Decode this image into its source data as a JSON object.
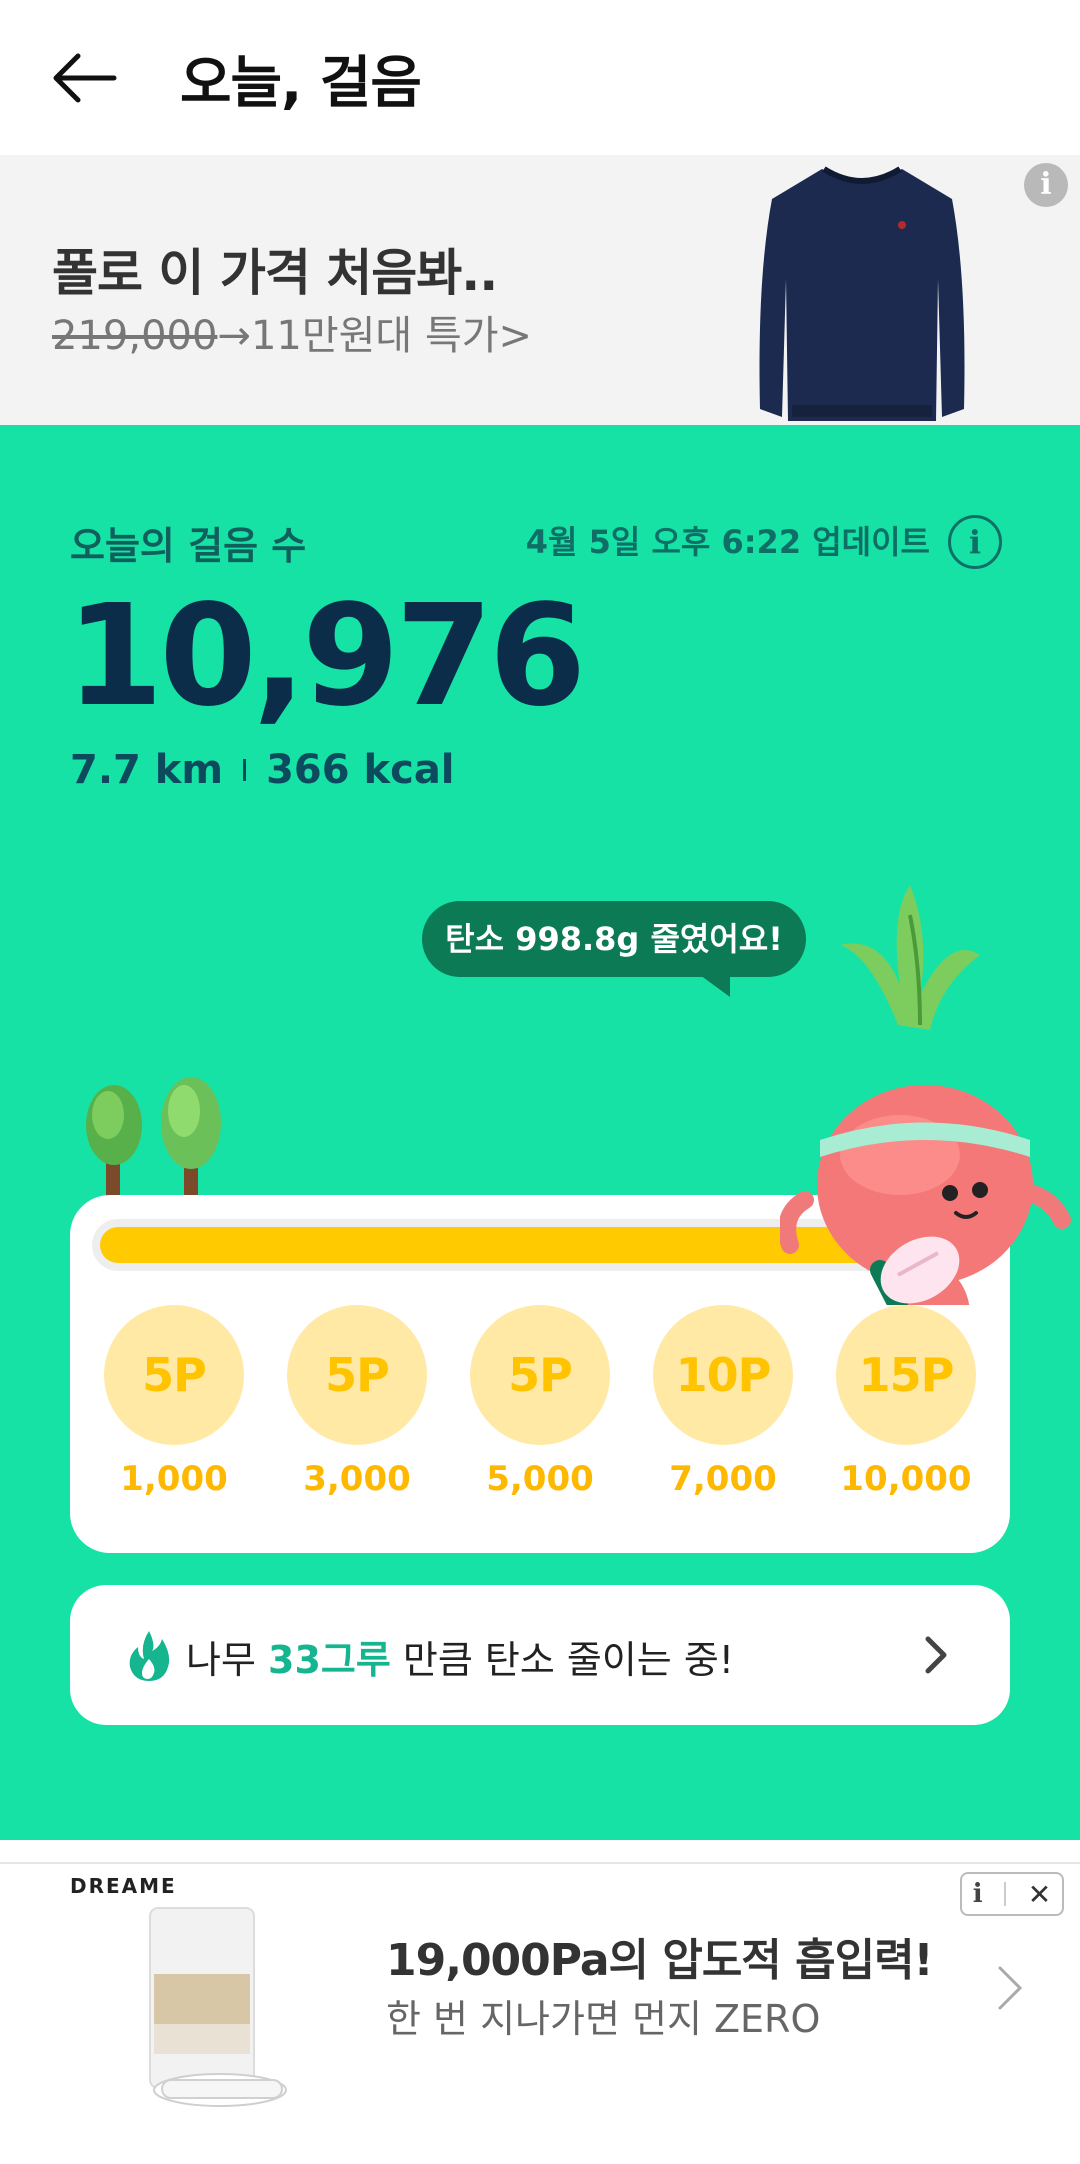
{
  "header": {
    "title": "오늘, 걸음"
  },
  "top_ad": {
    "title": "폴로 이 가격 처음봐..",
    "original_price": "219,000",
    "arrow_text": "→11만원대 특가>",
    "info_icon": "i"
  },
  "steps": {
    "label": "오늘의 걸음 수",
    "updated": "4월 5일 오후 6:22 업데이트",
    "info_icon": "i",
    "count": "10,976",
    "distance": "7.7 km",
    "calories": "366 kcal"
  },
  "bubble": {
    "text": "탄소 998.8g 줄였어요!"
  },
  "progress": {
    "fraction": 1.0,
    "rewards": [
      {
        "points": "5P",
        "goal": "1,000"
      },
      {
        "points": "5P",
        "goal": "3,000"
      },
      {
        "points": "5P",
        "goal": "5,000"
      },
      {
        "points": "10P",
        "goal": "7,000"
      },
      {
        "points": "15P",
        "goal": "10,000"
      }
    ]
  },
  "carbon": {
    "prefix": "나무 ",
    "highlight": "33그루",
    "suffix": " 만큼 탄소 줄이는 중!"
  },
  "bottom_ad": {
    "brand": "DREAME",
    "title": "19,000Pa의 압도적 흡입력!",
    "subtitle": "한 번 지나가면 먼지 ZERO",
    "info_icon": "i",
    "close_icon": "✕"
  },
  "colors": {
    "accent_green": "#16e2a6",
    "dark_navy": "#0c2d4a",
    "progress_yellow": "#ffcb00",
    "coin_bg": "#ffe9a4",
    "highlight_teal": "#14b58f",
    "bubble_green": "#0b7a55"
  }
}
